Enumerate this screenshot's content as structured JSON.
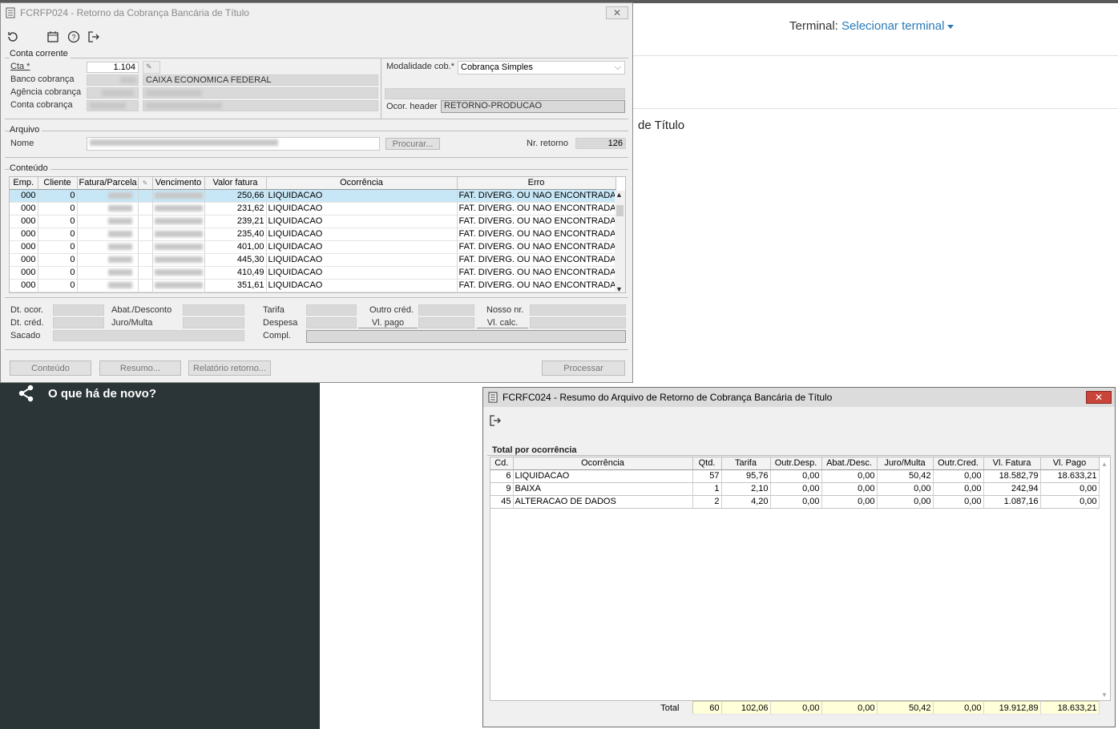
{
  "background": {
    "terminal_label": "Terminal:",
    "terminal_link": "Selecionar terminal",
    "page_title_fragment": "de Título",
    "news_label": "O que há de novo?"
  },
  "main_window": {
    "title": "FCRFP024 - Retorno da Cobrança Bancária de Título",
    "conta_corrente": {
      "group": "Conta corrente",
      "cta_label": "Cta *",
      "cta_value": "1.104",
      "banco_label": "Banco cobrança",
      "banco_name": "CAIXA ECONOMICA FEDERAL",
      "agencia_label": "Agência cobrança",
      "conta_label": "Conta cobrança",
      "modalidade_label": "Modalidade cob.*",
      "modalidade_value": "Cobrança Simples",
      "ocor_header_label": "Ocor. header",
      "ocor_header_value": "RETORNO-PRODUCAO"
    },
    "arquivo": {
      "group": "Arquivo",
      "nome_label": "Nome",
      "procurar": "Procurar...",
      "nr_retorno_label": "Nr. retorno",
      "nr_retorno_value": "126"
    },
    "conteudo": {
      "group": "Conteúdo",
      "columns": [
        "Emp.",
        "Cliente",
        "Fatura/Parcela",
        "Vencimento",
        "Valor fatura",
        "Ocorrência",
        "Erro"
      ],
      "rows": [
        {
          "emp": "000",
          "cliente": "0",
          "valor": "250,66",
          "ocorrencia": "LIQUIDACAO",
          "erro": "FAT. DIVERG. OU NAO ENCONTRADA"
        },
        {
          "emp": "000",
          "cliente": "0",
          "valor": "231,62",
          "ocorrencia": "LIQUIDACAO",
          "erro": "FAT. DIVERG. OU NAO ENCONTRADA"
        },
        {
          "emp": "000",
          "cliente": "0",
          "valor": "239,21",
          "ocorrencia": "LIQUIDACAO",
          "erro": "FAT. DIVERG. OU NAO ENCONTRADA"
        },
        {
          "emp": "000",
          "cliente": "0",
          "valor": "235,40",
          "ocorrencia": "LIQUIDACAO",
          "erro": "FAT. DIVERG. OU NAO ENCONTRADA"
        },
        {
          "emp": "000",
          "cliente": "0",
          "valor": "401,00",
          "ocorrencia": "LIQUIDACAO",
          "erro": "FAT. DIVERG. OU NAO ENCONTRADA"
        },
        {
          "emp": "000",
          "cliente": "0",
          "valor": "445,30",
          "ocorrencia": "LIQUIDACAO",
          "erro": "FAT. DIVERG. OU NAO ENCONTRADA"
        },
        {
          "emp": "000",
          "cliente": "0",
          "valor": "410,49",
          "ocorrencia": "LIQUIDACAO",
          "erro": "FAT. DIVERG. OU NAO ENCONTRADA"
        },
        {
          "emp": "000",
          "cliente": "0",
          "valor": "351,61",
          "ocorrencia": "LIQUIDACAO",
          "erro": "FAT. DIVERG. OU NAO ENCONTRADA"
        }
      ]
    },
    "details": {
      "dt_ocor": "Dt. ocor.",
      "dt_cred": "Dt. créd.",
      "sacado": "Sacado",
      "abat": "Abat./Desconto",
      "juro": "Juro/Multa",
      "tarifa": "Tarifa",
      "despesa": "Despesa",
      "compl": "Compl.",
      "outro_cred": "Outro créd.",
      "vl_pago": "Vl. pago",
      "nosso_nr": "Nosso nr.",
      "vl_calc": "Vl. calc."
    },
    "buttons": {
      "conteudo": "Conteúdo",
      "resumo": "Resumo...",
      "relatorio": "Relatório retorno...",
      "processar": "Processar"
    }
  },
  "summary_window": {
    "title": "FCRFC024 - Resumo do Arquivo de Retorno de Cobrança Bancária de Título",
    "group": "Total por ocorrência",
    "columns": [
      "Cd.",
      "Ocorrência",
      "Qtd.",
      "Tarifa",
      "Outr.Desp.",
      "Abat./Desc.",
      "Juro/Multa",
      "Outr.Cred.",
      "Vl. Fatura",
      "Vl. Pago"
    ],
    "rows": [
      {
        "cd": "6",
        "ocorrencia": "LIQUIDACAO",
        "qtd": "57",
        "tarifa": "95,76",
        "outr_desp": "0,00",
        "abat": "0,00",
        "juro": "50,42",
        "outr_cred": "0,00",
        "vl_fatura": "18.582,79",
        "vl_pago": "18.633,21"
      },
      {
        "cd": "9",
        "ocorrencia": "BAIXA",
        "qtd": "1",
        "tarifa": "2,10",
        "outr_desp": "0,00",
        "abat": "0,00",
        "juro": "0,00",
        "outr_cred": "0,00",
        "vl_fatura": "242,94",
        "vl_pago": "0,00"
      },
      {
        "cd": "45",
        "ocorrencia": "ALTERACAO DE DADOS",
        "qtd": "2",
        "tarifa": "4,20",
        "outr_desp": "0,00",
        "abat": "0,00",
        "juro": "0,00",
        "outr_cred": "0,00",
        "vl_fatura": "1.087,16",
        "vl_pago": "0,00"
      }
    ],
    "total": {
      "label": "Total",
      "qtd": "60",
      "tarifa": "102,06",
      "outr_desp": "0,00",
      "abat": "0,00",
      "juro": "50,42",
      "outr_cred": "0,00",
      "vl_fatura": "19.912,89",
      "vl_pago": "18.633,21"
    }
  }
}
